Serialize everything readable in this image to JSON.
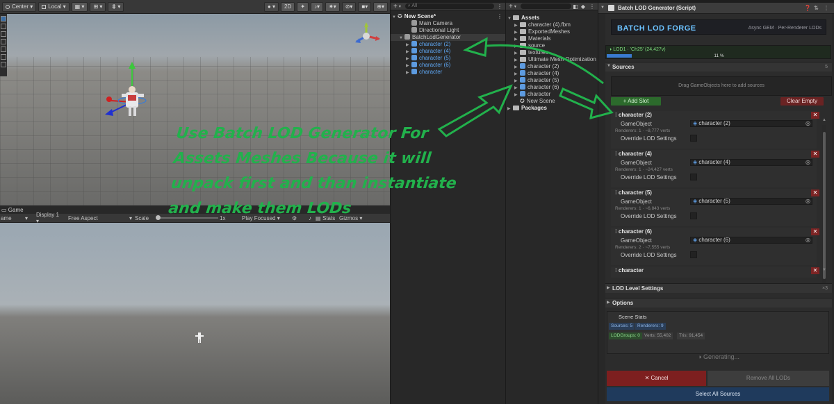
{
  "scene_toolbar": {
    "pivot": "Center",
    "space": "Local",
    "mode_2d": "2D"
  },
  "game_view": {
    "tab_label": "Game",
    "view_label": "ame",
    "display": "Display 1",
    "aspect": "Free Aspect",
    "scale_label": "Scale",
    "scale_value": "1x",
    "play_mode": "Play Focused",
    "stats": "Stats",
    "gizmos": "Gizmos"
  },
  "hierarchy": {
    "search_placeholder": "All",
    "scene_name": "New Scene*",
    "items": [
      {
        "label": "Main Camera",
        "indent": 2,
        "icon": "cube-grey-icon",
        "blue": false,
        "tri": false
      },
      {
        "label": "Directional Light",
        "indent": 2,
        "icon": "cube-grey-icon",
        "blue": false,
        "tri": false
      },
      {
        "label": "BatchLodGenerator",
        "indent": 1,
        "icon": "cube-grey-icon",
        "blue": false,
        "tri": true
      },
      {
        "label": "character (2)",
        "indent": 2,
        "icon": "prefab-icon",
        "blue": true,
        "tri": true
      },
      {
        "label": "character (4)",
        "indent": 2,
        "icon": "prefab-icon",
        "blue": true,
        "tri": true
      },
      {
        "label": "character (5)",
        "indent": 2,
        "icon": "prefab-icon",
        "blue": true,
        "tri": true
      },
      {
        "label": "character (6)",
        "indent": 2,
        "icon": "prefab-icon",
        "blue": true,
        "tri": true
      },
      {
        "label": "character",
        "indent": 2,
        "icon": "prefab-icon",
        "blue": true,
        "tri": true
      }
    ]
  },
  "project": {
    "root": "Assets",
    "items": [
      {
        "label": "character (4).fbm",
        "icon": "folder-icon"
      },
      {
        "label": "ExportedMeshes",
        "icon": "folder-icon"
      },
      {
        "label": "Materials",
        "icon": "folder-icon"
      },
      {
        "label": "source",
        "icon": "folder-icon"
      },
      {
        "label": "textures",
        "icon": "folder-icon"
      },
      {
        "label": "Ultimate Mesh Optimization S",
        "icon": "folder-icon"
      },
      {
        "label": "character (2)",
        "icon": "prefab-icon"
      },
      {
        "label": "character (4)",
        "icon": "prefab-icon"
      },
      {
        "label": "character (5)",
        "icon": "prefab-icon"
      },
      {
        "label": "character (6)",
        "icon": "prefab-icon"
      },
      {
        "label": "character",
        "icon": "prefab-icon"
      },
      {
        "label": "New Scene",
        "icon": "scene-icon"
      }
    ],
    "packages": "Packages"
  },
  "inspector": {
    "component_title": "Batch LOD Generator (Script)",
    "banner_title": "BATCH LOD FORGE",
    "banner_subtitle": "Async GEM · Per-Renderer LODs",
    "progress_label": "LOD1 · 'Ch25' (24,427v)",
    "progress_percent": "11 %",
    "progress_fraction": 0.11,
    "sources_header": "Sources",
    "sources_count": "5",
    "dropzone_text": "Drag GameObjects here to add sources",
    "add_slot": "Add Slot",
    "clear_empty": "Clear Empty",
    "gameobject_label": "GameObject",
    "override_label": "Override LOD Settings",
    "slots": [
      {
        "name": "character (2)",
        "object": "character (2)",
        "meta": "Renderers: 1 · ~8,777 verts"
      },
      {
        "name": "character (4)",
        "object": "character (4)",
        "meta": "Renderers: 1 · ~24,427 verts"
      },
      {
        "name": "character (5)",
        "object": "character (5)",
        "meta": "Renderers: 1 · ~6,843 verts"
      },
      {
        "name": "character (6)",
        "object": "character (6)",
        "meta": "Renderers: 2 · ~7,555 verts"
      },
      {
        "name": "character",
        "object": "",
        "meta": ""
      }
    ],
    "lod_level_header": "LOD Level Settings",
    "lod_level_count": "×3",
    "options_header": "Options",
    "stats_title": "Scene Stats",
    "stat_sources": "Sources: 5",
    "stat_renderers": "Renderers: 9",
    "stat_lodgroups": "LODGroups: 0",
    "stat_verts": "Verts: 55,402",
    "stat_tris": "Tris: 91,454",
    "generating": "Generating...",
    "cancel": "Cancel",
    "remove_all": "Remove All LODs",
    "select_all": "Select All Sources"
  },
  "annotation": {
    "line1": "Use Batch LOD Generator For",
    "line2": "Assets Meshes Because it will",
    "line3": "unpack first and than instantiate",
    "line4": "and make them LODs",
    "color": "#22b14c"
  }
}
